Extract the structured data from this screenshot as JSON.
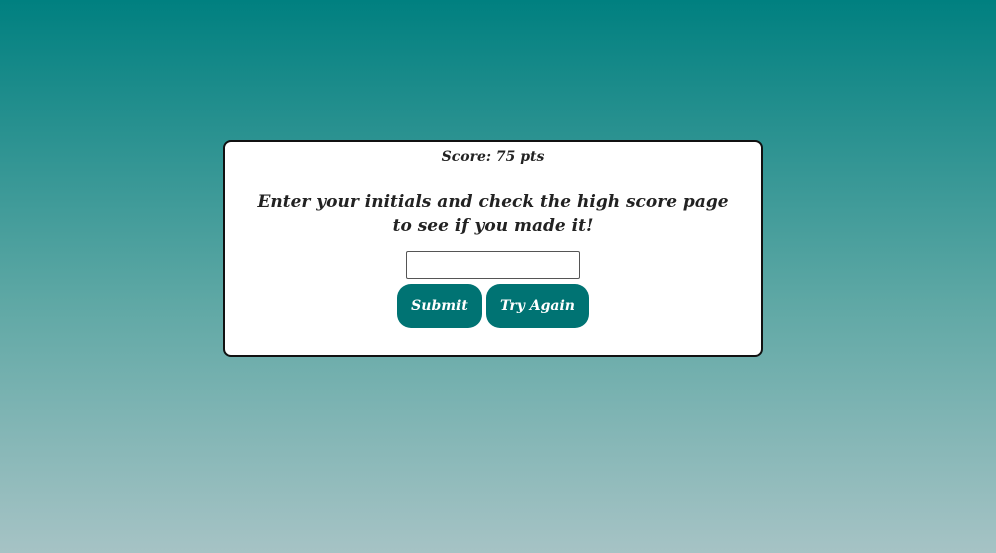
{
  "result": {
    "score_label": "Score:",
    "score_value": "75",
    "score_unit": "pts",
    "prompt": "Enter your initials and check the high score page to see if you made it!"
  },
  "initials_input": {
    "value": "",
    "placeholder": ""
  },
  "buttons": {
    "submit_label": "Submit",
    "try_again_label": "Try Again"
  },
  "colors": {
    "background_top": "#008080",
    "background_bottom": "#a6c3c5",
    "button": "#007373",
    "card": "#ffffff"
  }
}
